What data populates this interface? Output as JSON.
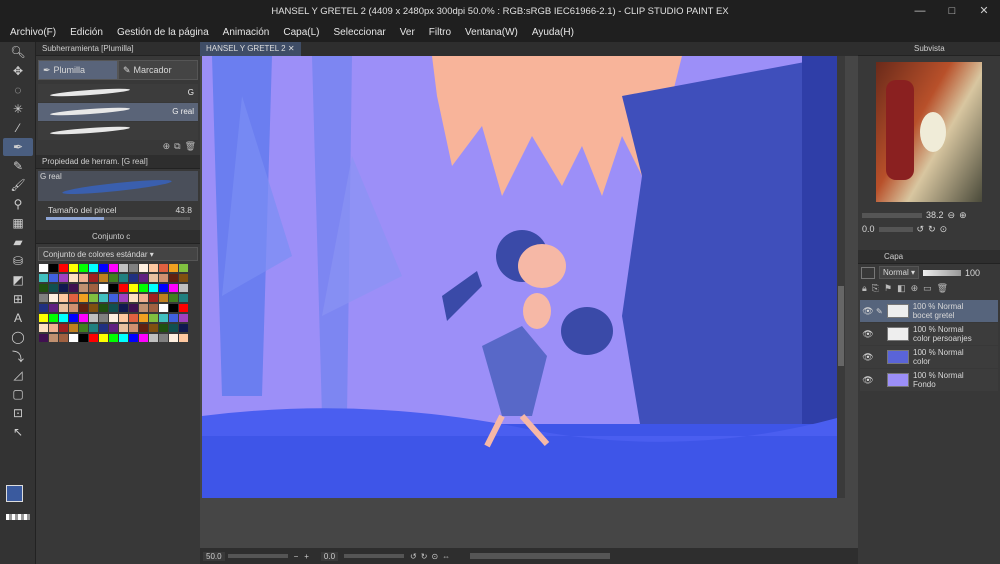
{
  "window": {
    "title": "HANSEL Y GRETEL 2 (4409 x 2480px 300dpi 50.0% : RGB:sRGB IEC61966-2.1) - CLIP STUDIO PAINT EX",
    "controls": [
      "—",
      "□",
      "✕"
    ]
  },
  "menu": [
    "Archivo(F)",
    "Edición",
    "Gestión de la página",
    "Animación",
    "Capa(L)",
    "Seleccionar",
    "Ver",
    "Filtro",
    "Ventana(W)",
    "Ayuda(H)"
  ],
  "subtool": {
    "header": "Subherramienta [Plumilla]",
    "tabs": [
      "Plumilla",
      "Marcador"
    ],
    "brushes": [
      "G",
      "G real",
      ""
    ]
  },
  "toolprop": {
    "header": "Propiedad de herram. [G real]",
    "brush_name": "G real",
    "size_label": "Tamaño del pincel",
    "size_value": "43.8"
  },
  "colorset": {
    "tab": "Conjunto c",
    "dropdown": "Conjunto de colores estándar"
  },
  "doc_tab": "HANSEL Y GRETEL 2",
  "status": {
    "zoom": "50.0",
    "angle": "0.0"
  },
  "navigator": {
    "tab": "Subvista",
    "zoom": "38.2",
    "angle": "0.0"
  },
  "layers": {
    "tab": "Capa",
    "blend": "Normal",
    "opacity": "100",
    "items": [
      {
        "line1": "100 % Normal",
        "line2": "bocet gretel"
      },
      {
        "line1": "100 % Normal",
        "line2": "color persoanjes"
      },
      {
        "line1": "100 % Normal",
        "line2": "color"
      },
      {
        "line1": "100 % Normal",
        "line2": "Fondo"
      }
    ]
  },
  "colors": {
    "accent": "#4a5e80",
    "main_color": "#3a5a9e",
    "sub_color": "#ffffff"
  }
}
